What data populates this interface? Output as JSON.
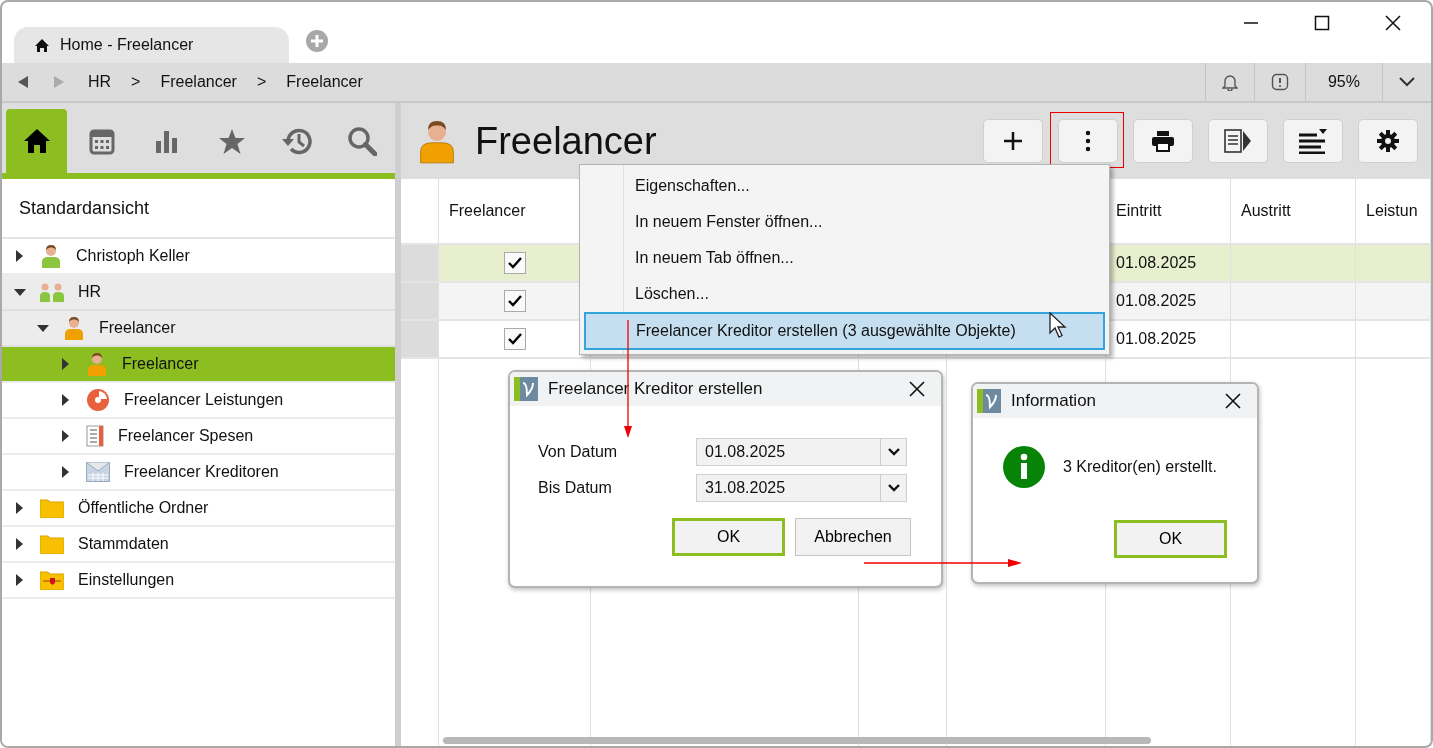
{
  "window": {
    "tab": {
      "label": "Home - Freelancer",
      "selected": true
    }
  },
  "nav": {
    "breadcrumb": [
      "HR",
      "Freelancer",
      "Freelancer"
    ],
    "separator": ">",
    "zoom": "95%"
  },
  "sidebar": {
    "tabs": [
      {
        "kind": "home",
        "selected": true
      },
      {
        "kind": "calendar",
        "selected": false
      },
      {
        "kind": "chart",
        "selected": false
      },
      {
        "kind": "star",
        "selected": false
      },
      {
        "kind": "history",
        "selected": false
      },
      {
        "kind": "search",
        "selected": false
      }
    ],
    "view_title": "Standardansicht",
    "tree": [
      {
        "label": "Christoph Keller",
        "kind": "person-green",
        "expanded": false,
        "selected": false
      },
      {
        "label": "HR",
        "kind": "group",
        "expanded": true,
        "selected": false,
        "children": [
          {
            "label": "Freelancer",
            "kind": "person-orange",
            "expanded": true,
            "selected": false,
            "children": [
              {
                "label": "Freelancer",
                "kind": "person-orange",
                "expanded": false,
                "selected": true
              },
              {
                "label": "Freelancer Leistungen",
                "kind": "pie",
                "expanded": false,
                "selected": false
              },
              {
                "label": "Freelancer Spesen",
                "kind": "list",
                "expanded": false,
                "selected": false
              },
              {
                "label": "Freelancer Kreditoren",
                "kind": "mail",
                "expanded": false,
                "selected": false
              }
            ]
          }
        ]
      },
      {
        "label": "Öffentliche Ordner",
        "kind": "folder",
        "expanded": false,
        "selected": false
      },
      {
        "label": "Stammdaten",
        "kind": "folder",
        "expanded": false,
        "selected": false
      },
      {
        "label": "Einstellungen",
        "kind": "folder-settings",
        "expanded": false,
        "selected": false
      }
    ]
  },
  "page": {
    "title": "Freelancer",
    "toolbar": [
      {
        "kind": "add",
        "highlighted": false
      },
      {
        "kind": "more",
        "highlighted": true
      },
      {
        "kind": "print",
        "highlighted": false
      },
      {
        "kind": "export",
        "highlighted": false
      },
      {
        "kind": "sort",
        "highlighted": false
      },
      {
        "kind": "settings",
        "highlighted": false
      }
    ]
  },
  "table": {
    "columns": [
      "Freelancer",
      "",
      "",
      "",
      "Eintritt",
      "Austritt",
      "Leistun"
    ],
    "rows": [
      {
        "selected": true,
        "checked": true,
        "eintritt": "01.08.2025"
      },
      {
        "selected": false,
        "checked": true,
        "eintritt": "01.08.2025"
      },
      {
        "selected": false,
        "checked": true,
        "eintritt": "01.08.2025"
      }
    ]
  },
  "context_menu": [
    {
      "label": "Eigenschaften...",
      "selected": false
    },
    {
      "label": "In neuem Fenster öffnen...",
      "selected": false
    },
    {
      "label": "In neuem Tab öffnen...",
      "selected": false
    },
    {
      "label": "Löschen...",
      "selected": false
    },
    {
      "label": "Freelancer Kreditor erstellen (3 ausgewählte Objekte)",
      "selected": true
    }
  ],
  "dialog": {
    "title": "Freelancer Kreditor erstellen",
    "fields": [
      {
        "label": "Von Datum",
        "value": "01.08.2025"
      },
      {
        "label": "Bis Datum",
        "value": "31.08.2025"
      }
    ],
    "buttons": [
      {
        "label": "OK",
        "default": true
      },
      {
        "label": "Abbrechen",
        "default": false
      }
    ]
  },
  "info_dialog": {
    "title": "Information",
    "message": "3 Kreditor(en) erstellt.",
    "buttons": [
      {
        "label": "OK",
        "default": true
      }
    ]
  }
}
